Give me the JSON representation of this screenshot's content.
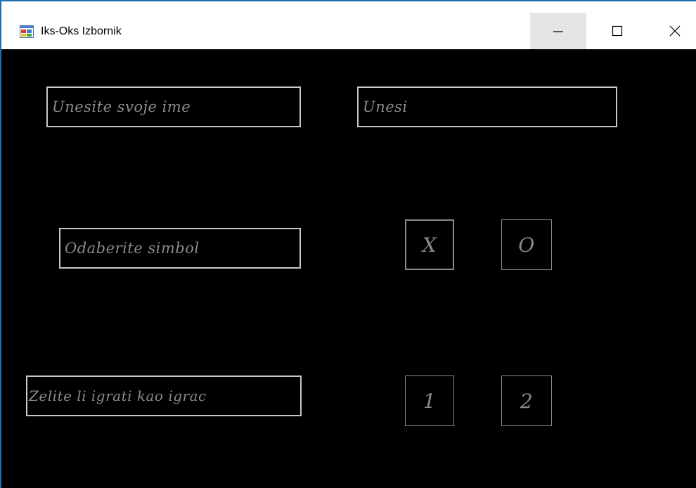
{
  "window": {
    "title": "Iks-Oks Izbornik",
    "icon": "winforms-app-icon",
    "controls": {
      "minimize_icon": "minimize-icon",
      "maximize_icon": "maximize-icon",
      "close_icon": "close-icon"
    }
  },
  "form": {
    "name_label": "Unesite svoje ime",
    "name_input": {
      "value": "",
      "placeholder": "Unesi"
    },
    "symbol_label": "Odaberite simbol",
    "symbol_options": [
      "X",
      "O"
    ],
    "player_label": "Zelite li igrati kao igrac",
    "player_options": [
      "1",
      "2"
    ]
  },
  "colors": {
    "background": "#000000",
    "text": "#8a8a8a",
    "label_border": "#c8c8c8",
    "titlebar": "#ffffff",
    "minimize_hover": "#e5e5e5"
  }
}
